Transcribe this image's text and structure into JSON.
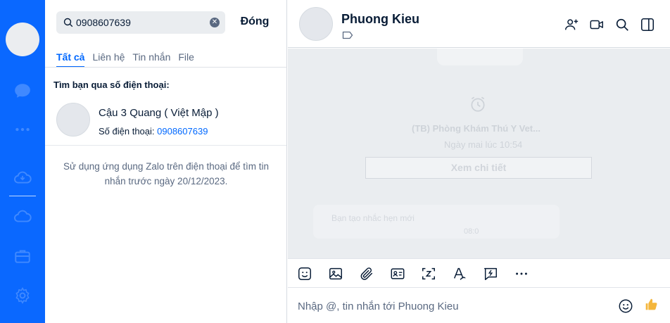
{
  "app": {
    "accent": "#0068ff",
    "rail_color": "#0a68ff"
  },
  "rail": {
    "icons": [
      "chat-icon",
      "more-dots-icon",
      "cloud-sync-icon",
      "cloud-icon",
      "briefcase-icon",
      "settings-gear-icon"
    ]
  },
  "search": {
    "value": "0908607639",
    "close_label": "Đóng",
    "tabs": [
      {
        "label": "Tất cả",
        "active": true
      },
      {
        "label": "Liên hệ",
        "active": false
      },
      {
        "label": "Tin nhắn",
        "active": false
      },
      {
        "label": "File",
        "active": false
      }
    ],
    "section_title": "Tìm bạn qua số điện thoại:",
    "result": {
      "name": "Cậu 3 Quang ( Việt Mập )",
      "phone_label": "Số điện thoại: ",
      "phone_number": "0908607639"
    },
    "hint": "Sử dụng ứng dụng Zalo trên điện thoại để tìm tin nhắn trước ngày 20/12/2023."
  },
  "chat": {
    "contact_name": "Phuong Kieu",
    "header_icons": [
      "add-member-icon",
      "video-call-icon",
      "search-icon",
      "sidebar-toggle-icon"
    ],
    "background_items": {
      "reminder_title": "(TB) Phòng Khám Thú Y  Vet...",
      "reminder_time": "Ngày mai lúc 10:54",
      "reminder_button": "Xem chi tiết",
      "message_text": "Bạn tạo nhắc hẹn mới",
      "message_time": "08:0"
    },
    "toolbar_icons": [
      "sticker-icon",
      "image-icon",
      "attachment-icon",
      "contact-card-icon",
      "screenshot-icon",
      "text-format-icon",
      "quick-message-icon",
      "more-options-icon"
    ],
    "composer_placeholder": "Nhập @, tin nhắn tới Phuong Kieu"
  }
}
